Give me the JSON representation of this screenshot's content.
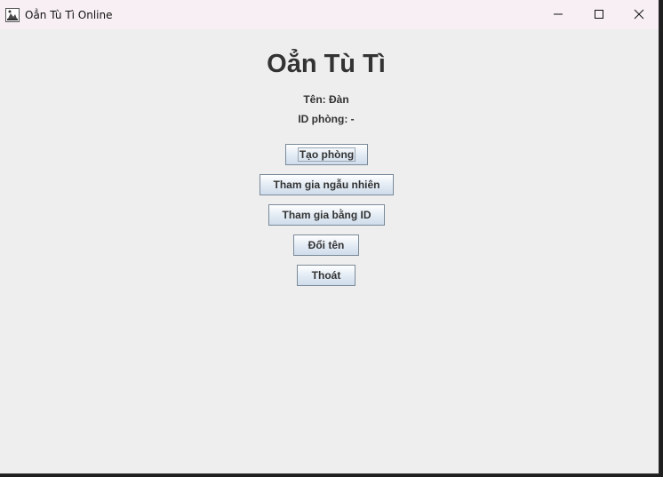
{
  "window": {
    "title": "Oẳn Tù Tì Online",
    "app_icon": "java-app-icon",
    "controls": {
      "minimize_icon": "minimize-icon",
      "maximize_icon": "maximize-icon",
      "close_icon": "close-icon"
    }
  },
  "main": {
    "title": "Oẳn Tù Tì",
    "player_name": "Tên: Đàn",
    "room_id": "ID phòng: -"
  },
  "buttons": {
    "create_room": "Tạo phòng",
    "join_random": "Tham gia ngẫu nhiên",
    "join_by_id": "Tham gia bằng ID",
    "rename": "Đổi tên",
    "exit": "Thoát"
  },
  "colors": {
    "background": "#eeeeee",
    "titlebar": "#f7eff4",
    "text": "#333333",
    "button_border": "#7a8a99"
  }
}
